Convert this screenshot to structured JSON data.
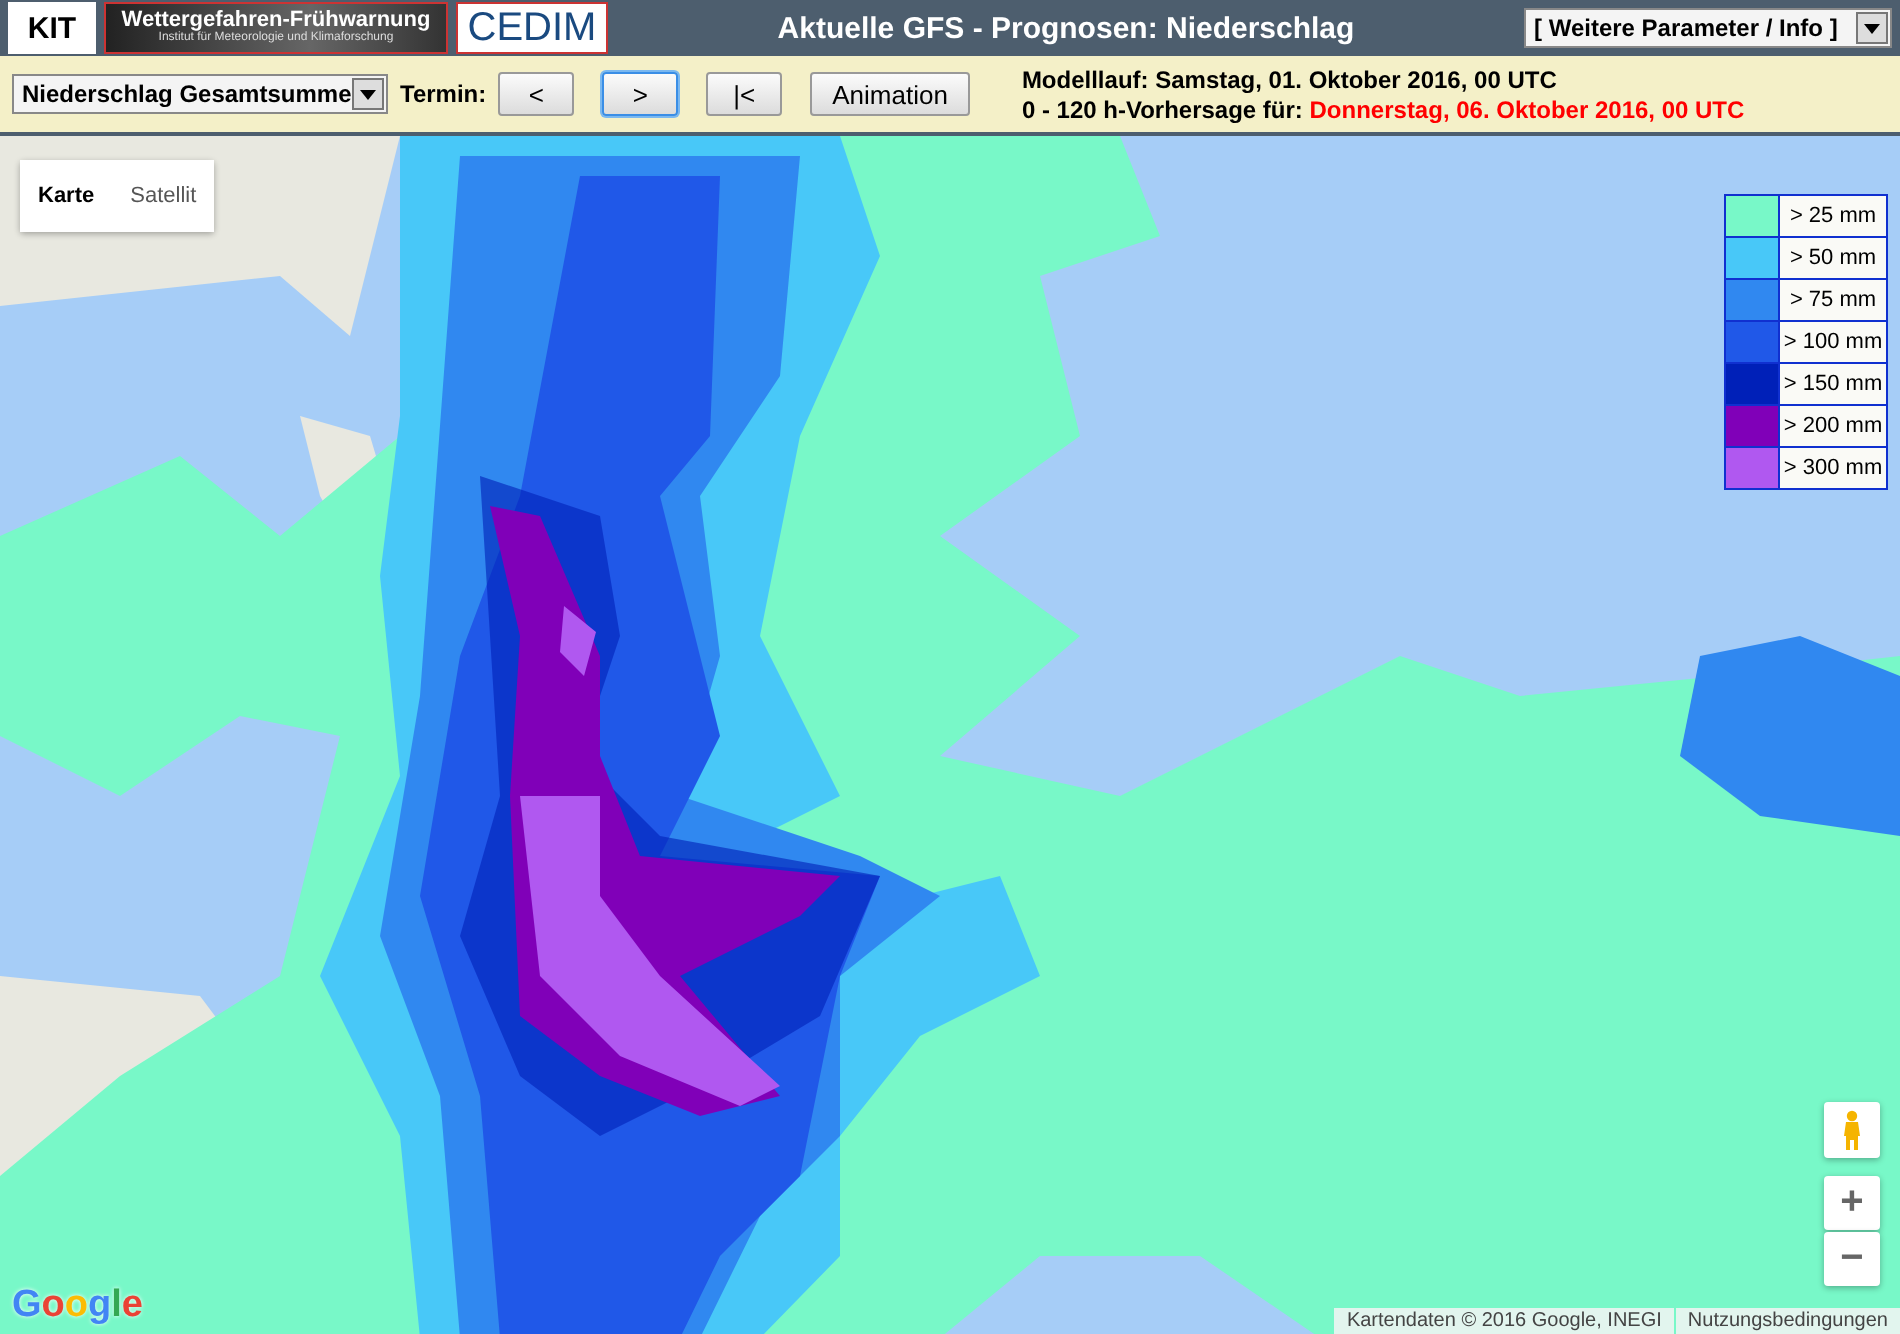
{
  "header": {
    "logos": [
      {
        "kind": "kit",
        "text": "KIT"
      },
      {
        "kind": "banner",
        "text": "Wettergefahren-Frühwarnung",
        "subtext": "Institut für Meteorologie und Klimaforschung"
      },
      {
        "kind": "cedim",
        "text": "CEDIM"
      }
    ],
    "title": "Aktuelle GFS - Prognosen: Niederschlag",
    "menu": {
      "value": "[ Weitere Parameter / Info ]"
    }
  },
  "toolbar": {
    "parameter": {
      "value": "Niederschlag Gesamtsumme"
    },
    "termin_label": "Termin:",
    "buttons": [
      {
        "label": "<",
        "selected": false
      },
      {
        "label": ">",
        "selected": true
      },
      {
        "label": "|<",
        "selected": false
      },
      {
        "label": "Animation",
        "selected": false
      }
    ],
    "model_run": {
      "label": "Modelllauf:",
      "value": "Samstag, 01. Oktober 2016, 00 UTC"
    },
    "forecast": {
      "label": "0 - 120 h-Vorhersage für:",
      "value": "Donnerstag, 06. Oktober 2016, 00 UTC"
    }
  },
  "map": {
    "map_types": [
      {
        "label": "Karte",
        "selected": true
      },
      {
        "label": "Satellit",
        "selected": false
      }
    ],
    "legend": [
      {
        "label": "> 25 mm",
        "color": "#78f8c8"
      },
      {
        "label": "> 50 mm",
        "color": "#48c8f8"
      },
      {
        "label": "> 75 mm",
        "color": "#3088f0"
      },
      {
        "label": "> 100 mm",
        "color": "#2058e8"
      },
      {
        "label": "> 150 mm",
        "color": "#0020b8"
      },
      {
        "label": "> 200 mm",
        "color": "#8000b8"
      },
      {
        "label": "> 300 mm",
        "color": "#b058f0"
      }
    ],
    "zoom": [
      "+",
      "−"
    ],
    "logo": "Google",
    "attribution": "Kartendaten © 2016 Google, INEGI",
    "terms": "Nutzungsbedingungen"
  }
}
